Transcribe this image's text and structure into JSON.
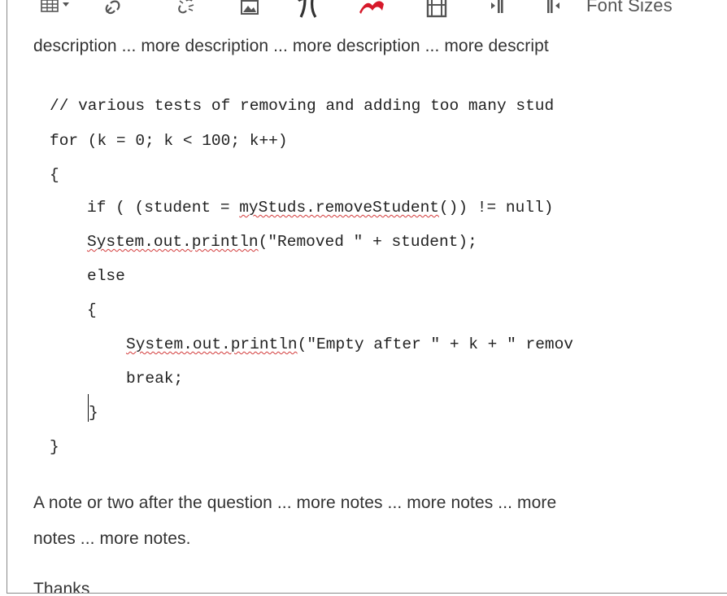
{
  "toolbar": {
    "items": [
      {
        "name": "table-icon"
      },
      {
        "name": "link-icon"
      },
      {
        "name": "unlink-icon"
      },
      {
        "name": "image-icon"
      },
      {
        "name": "pi-icon"
      },
      {
        "name": "flash-icon"
      },
      {
        "name": "media-icon"
      },
      {
        "name": "ltr-icon"
      },
      {
        "name": "rtl-icon"
      }
    ],
    "font_sizes_label": "Font Sizes"
  },
  "content": {
    "description_line": "description ... more description ... more description ... more descript",
    "code": {
      "comment": "// various tests of removing and adding too many stud",
      "for_line": "for (k = 0; k < 100; k++)",
      "open_brace": "{",
      "if_prefix": "if ( (student = ",
      "if_squiggle": "myStuds.removeStudent",
      "if_suffix": "()) != null)",
      "println1_squiggle": "System.out.println",
      "println1_suffix": "(\"Removed \" + student);",
      "else_line": "else",
      "inner_open": "{",
      "println2_squiggle": "System.out.println",
      "println2_suffix": "(\"Empty after \" + k + \" remov",
      "break_line": "break;",
      "inner_close": "}",
      "close_brace": "}"
    },
    "notes_line1": "A note or two after the question ... more notes ... more notes ... more",
    "notes_line2": "notes ... more notes.",
    "thanks": "Thanks"
  }
}
